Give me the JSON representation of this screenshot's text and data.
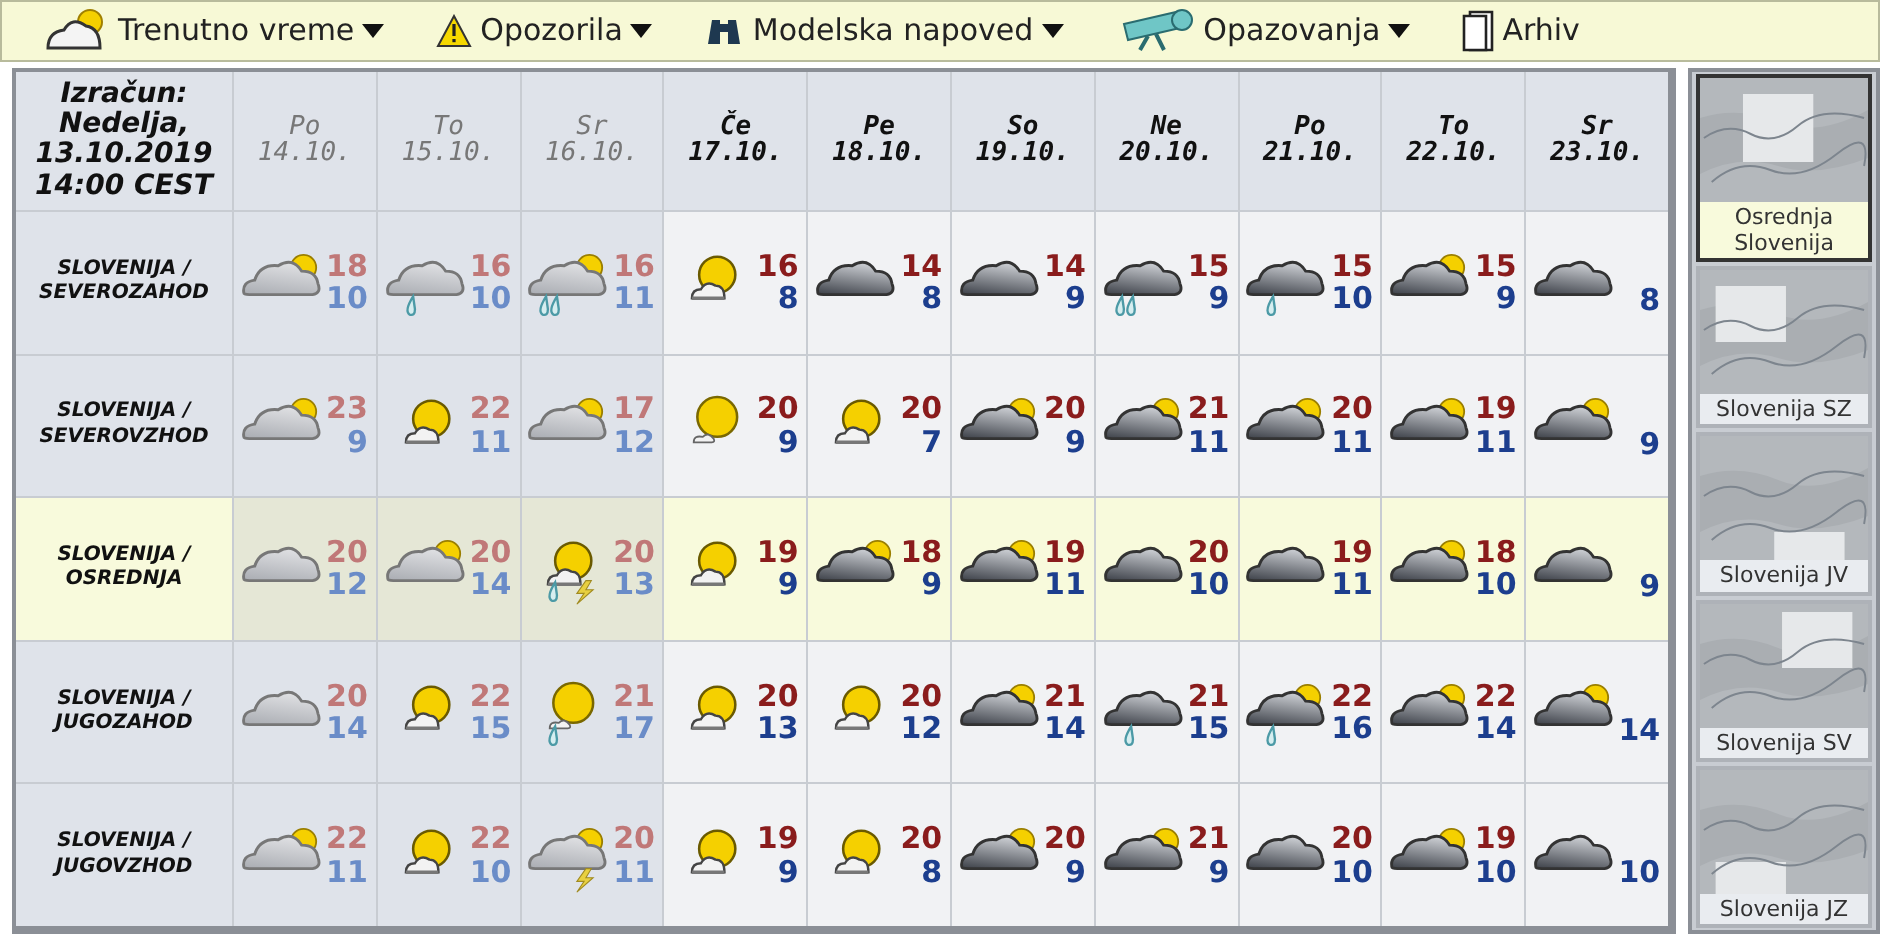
{
  "menu": [
    {
      "label": "Trenutno vreme",
      "dropdown": true
    },
    {
      "label": "Opozorila",
      "dropdown": true
    },
    {
      "label": "Modelska napoved",
      "dropdown": true
    },
    {
      "label": "Opazovanja",
      "dropdown": true
    },
    {
      "label": "Arhiv",
      "dropdown": false
    }
  ],
  "table": {
    "corner": [
      "Izračun:",
      "Nedelja,",
      "13.10.2019",
      "14:00 CEST"
    ],
    "columns": [
      {
        "day": "Po",
        "date": "14.10.",
        "past": true
      },
      {
        "day": "To",
        "date": "15.10.",
        "past": true
      },
      {
        "day": "Sr",
        "date": "16.10.",
        "past": true
      },
      {
        "day": "Če",
        "date": "17.10.",
        "past": false
      },
      {
        "day": "Pe",
        "date": "18.10.",
        "past": false
      },
      {
        "day": "So",
        "date": "19.10.",
        "past": false
      },
      {
        "day": "Ne",
        "date": "20.10.",
        "past": false
      },
      {
        "day": "Po",
        "date": "21.10.",
        "past": false
      },
      {
        "day": "To",
        "date": "22.10.",
        "past": false
      },
      {
        "day": "Sr",
        "date": "23.10.",
        "past": false
      }
    ],
    "rows": [
      {
        "region": [
          "SLOVENIJA /",
          "SEVEROZAHOD"
        ],
        "selected": false,
        "cells": [
          {
            "kind": "partly",
            "rain": false,
            "showers": false,
            "thunder": false,
            "max": "18",
            "min": "10"
          },
          {
            "kind": "overcast",
            "rain": true,
            "showers": false,
            "thunder": false,
            "max": "16",
            "min": "10"
          },
          {
            "kind": "partly",
            "rain": false,
            "showers": true,
            "thunder": false,
            "max": "16",
            "min": "11"
          },
          {
            "kind": "sunny",
            "rain": false,
            "showers": false,
            "thunder": false,
            "max": "16",
            "min": "8"
          },
          {
            "kind": "overcast",
            "rain": false,
            "showers": false,
            "thunder": false,
            "max": "14",
            "min": "8"
          },
          {
            "kind": "overcast",
            "rain": false,
            "showers": false,
            "thunder": false,
            "max": "14",
            "min": "9"
          },
          {
            "kind": "overcast",
            "rain": false,
            "showers": true,
            "thunder": false,
            "max": "15",
            "min": "9"
          },
          {
            "kind": "overcast",
            "rain": true,
            "showers": false,
            "thunder": false,
            "max": "15",
            "min": "10"
          },
          {
            "kind": "partly",
            "rain": false,
            "showers": false,
            "thunder": false,
            "max": "15",
            "min": "9"
          },
          {
            "kind": "overcast",
            "rain": false,
            "showers": false,
            "thunder": false,
            "min": "8"
          }
        ]
      },
      {
        "region": [
          "SLOVENIJA /",
          "SEVEROVZHOD"
        ],
        "selected": false,
        "cells": [
          {
            "kind": "partly",
            "rain": false,
            "showers": false,
            "thunder": false,
            "max": "23",
            "min": "9"
          },
          {
            "kind": "sunny",
            "rain": false,
            "showers": false,
            "thunder": false,
            "max": "22",
            "min": "11"
          },
          {
            "kind": "partly",
            "rain": false,
            "showers": false,
            "thunder": false,
            "max": "17",
            "min": "12"
          },
          {
            "kind": "clear",
            "rain": false,
            "showers": false,
            "thunder": false,
            "max": "20",
            "min": "9"
          },
          {
            "kind": "sunny",
            "rain": false,
            "showers": false,
            "thunder": false,
            "max": "20",
            "min": "7"
          },
          {
            "kind": "partly",
            "rain": false,
            "showers": false,
            "thunder": false,
            "max": "20",
            "min": "9"
          },
          {
            "kind": "partly",
            "rain": false,
            "showers": false,
            "thunder": false,
            "max": "21",
            "min": "11"
          },
          {
            "kind": "partly",
            "rain": false,
            "showers": false,
            "thunder": false,
            "max": "20",
            "min": "11"
          },
          {
            "kind": "partly",
            "rain": false,
            "showers": false,
            "thunder": false,
            "max": "19",
            "min": "11"
          },
          {
            "kind": "partly",
            "rain": false,
            "showers": false,
            "thunder": false,
            "min": "9"
          }
        ]
      },
      {
        "region": [
          "SLOVENIJA /",
          "OSREDNJA"
        ],
        "selected": true,
        "cells": [
          {
            "kind": "overcast",
            "rain": false,
            "showers": false,
            "thunder": false,
            "max": "20",
            "min": "12"
          },
          {
            "kind": "partly",
            "rain": false,
            "showers": false,
            "thunder": false,
            "max": "20",
            "min": "14"
          },
          {
            "kind": "sunny",
            "rain": true,
            "showers": false,
            "thunder": true,
            "max": "20",
            "min": "13"
          },
          {
            "kind": "sunny",
            "rain": false,
            "showers": false,
            "thunder": false,
            "max": "19",
            "min": "9"
          },
          {
            "kind": "partly",
            "rain": false,
            "showers": false,
            "thunder": false,
            "max": "18",
            "min": "9"
          },
          {
            "kind": "partly",
            "rain": false,
            "showers": false,
            "thunder": false,
            "max": "19",
            "min": "11"
          },
          {
            "kind": "overcast",
            "rain": false,
            "showers": false,
            "thunder": false,
            "max": "20",
            "min": "10"
          },
          {
            "kind": "overcast",
            "rain": false,
            "showers": false,
            "thunder": false,
            "max": "19",
            "min": "11"
          },
          {
            "kind": "partly",
            "rain": false,
            "showers": false,
            "thunder": false,
            "max": "18",
            "min": "10"
          },
          {
            "kind": "overcast",
            "rain": false,
            "showers": false,
            "thunder": false,
            "min": "9"
          }
        ]
      },
      {
        "region": [
          "SLOVENIJA /",
          "JUGOZAHOD"
        ],
        "selected": false,
        "cells": [
          {
            "kind": "overcast",
            "rain": false,
            "showers": false,
            "thunder": false,
            "max": "20",
            "min": "14"
          },
          {
            "kind": "sunny",
            "rain": false,
            "showers": false,
            "thunder": false,
            "max": "22",
            "min": "15"
          },
          {
            "kind": "clear",
            "rain": true,
            "showers": false,
            "thunder": false,
            "max": "21",
            "min": "17"
          },
          {
            "kind": "sunny",
            "rain": false,
            "showers": false,
            "thunder": false,
            "max": "20",
            "min": "13"
          },
          {
            "kind": "sunny",
            "rain": false,
            "showers": false,
            "thunder": false,
            "max": "20",
            "min": "12"
          },
          {
            "kind": "partly",
            "rain": false,
            "showers": false,
            "thunder": false,
            "max": "21",
            "min": "14"
          },
          {
            "kind": "overcast",
            "rain": true,
            "showers": false,
            "thunder": false,
            "max": "21",
            "min": "15"
          },
          {
            "kind": "partly",
            "rain": true,
            "showers": false,
            "thunder": false,
            "max": "22",
            "min": "16"
          },
          {
            "kind": "partly",
            "rain": false,
            "showers": false,
            "thunder": false,
            "max": "22",
            "min": "14"
          },
          {
            "kind": "partly",
            "rain": false,
            "showers": false,
            "thunder": false,
            "min": "14"
          }
        ]
      },
      {
        "region": [
          "SLOVENIJA /",
          "JUGOVZHOD"
        ],
        "selected": false,
        "cells": [
          {
            "kind": "partly",
            "rain": false,
            "showers": false,
            "thunder": false,
            "max": "22",
            "min": "11"
          },
          {
            "kind": "sunny",
            "rain": false,
            "showers": false,
            "thunder": false,
            "max": "22",
            "min": "10"
          },
          {
            "kind": "partly",
            "rain": false,
            "showers": false,
            "thunder": true,
            "max": "20",
            "min": "11"
          },
          {
            "kind": "sunny",
            "rain": false,
            "showers": false,
            "thunder": false,
            "max": "19",
            "min": "9"
          },
          {
            "kind": "sunny",
            "rain": false,
            "showers": false,
            "thunder": false,
            "max": "20",
            "min": "8"
          },
          {
            "kind": "partly",
            "rain": false,
            "showers": false,
            "thunder": false,
            "max": "20",
            "min": "9"
          },
          {
            "kind": "partly",
            "rain": false,
            "showers": false,
            "thunder": false,
            "max": "21",
            "min": "9"
          },
          {
            "kind": "overcast",
            "rain": false,
            "showers": false,
            "thunder": false,
            "max": "20",
            "min": "10"
          },
          {
            "kind": "partly",
            "rain": false,
            "showers": false,
            "thunder": false,
            "max": "19",
            "min": "10"
          },
          {
            "kind": "overcast",
            "rain": false,
            "showers": false,
            "thunder": false,
            "min": "10"
          }
        ]
      }
    ]
  },
  "regions": [
    {
      "label": "Osrednja Slovenija",
      "selected": true
    },
    {
      "label": "Slovenija SZ",
      "selected": false
    },
    {
      "label": "Slovenija JV",
      "selected": false
    },
    {
      "label": "Slovenija SV",
      "selected": false
    },
    {
      "label": "Slovenija JZ",
      "selected": false
    }
  ]
}
